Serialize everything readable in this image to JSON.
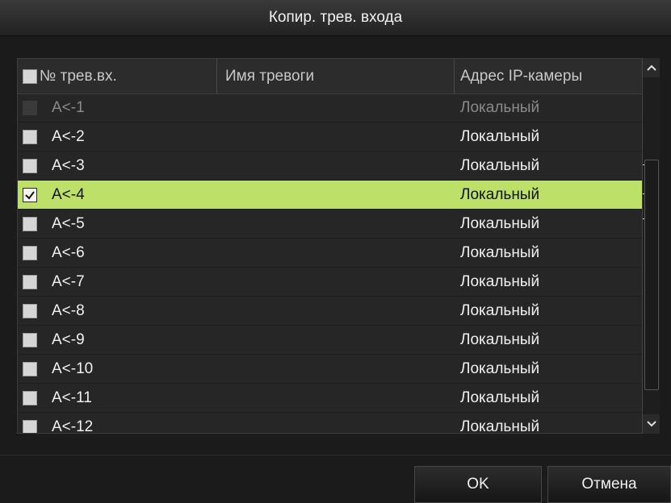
{
  "dialog": {
    "title": "Копир. трев. входа"
  },
  "table": {
    "columns": [
      "№ трев.вх.",
      "Имя тревоги",
      "Адрес IP-камеры"
    ],
    "rows": [
      {
        "no": "A<-1",
        "name": "",
        "address": "Локальный",
        "checked": false,
        "disabled": true,
        "selected": false
      },
      {
        "no": "A<-2",
        "name": "",
        "address": "Локальный",
        "checked": false,
        "disabled": false,
        "selected": false
      },
      {
        "no": "A<-3",
        "name": "",
        "address": "Локальный",
        "checked": false,
        "disabled": false,
        "selected": false
      },
      {
        "no": "A<-4",
        "name": "",
        "address": "Локальный",
        "checked": true,
        "disabled": false,
        "selected": true
      },
      {
        "no": "A<-5",
        "name": "",
        "address": "Локальный",
        "checked": false,
        "disabled": false,
        "selected": false
      },
      {
        "no": "A<-6",
        "name": "",
        "address": "Локальный",
        "checked": false,
        "disabled": false,
        "selected": false
      },
      {
        "no": "A<-7",
        "name": "",
        "address": "Локальный",
        "checked": false,
        "disabled": false,
        "selected": false
      },
      {
        "no": "A<-8",
        "name": "",
        "address": "Локальный",
        "checked": false,
        "disabled": false,
        "selected": false
      },
      {
        "no": "A<-9",
        "name": "",
        "address": "Локальный",
        "checked": false,
        "disabled": false,
        "selected": false
      },
      {
        "no": "A<-10",
        "name": "",
        "address": "Локальный",
        "checked": false,
        "disabled": false,
        "selected": false
      },
      {
        "no": "A<-11",
        "name": "",
        "address": "Локальный",
        "checked": false,
        "disabled": false,
        "selected": false
      },
      {
        "no": "A<-12",
        "name": "",
        "address": "Локальный",
        "checked": false,
        "disabled": false,
        "selected": false
      }
    ]
  },
  "buttons": {
    "ok": "OK",
    "cancel": "Отмена"
  },
  "colors": {
    "selected_row": "#bde068",
    "background": "#1b1b1b",
    "header": "#2c2c2c"
  },
  "icons": {
    "scroll_up": "chevron-up-icon",
    "scroll_down": "chevron-down-icon",
    "check": "checkmark-icon"
  }
}
